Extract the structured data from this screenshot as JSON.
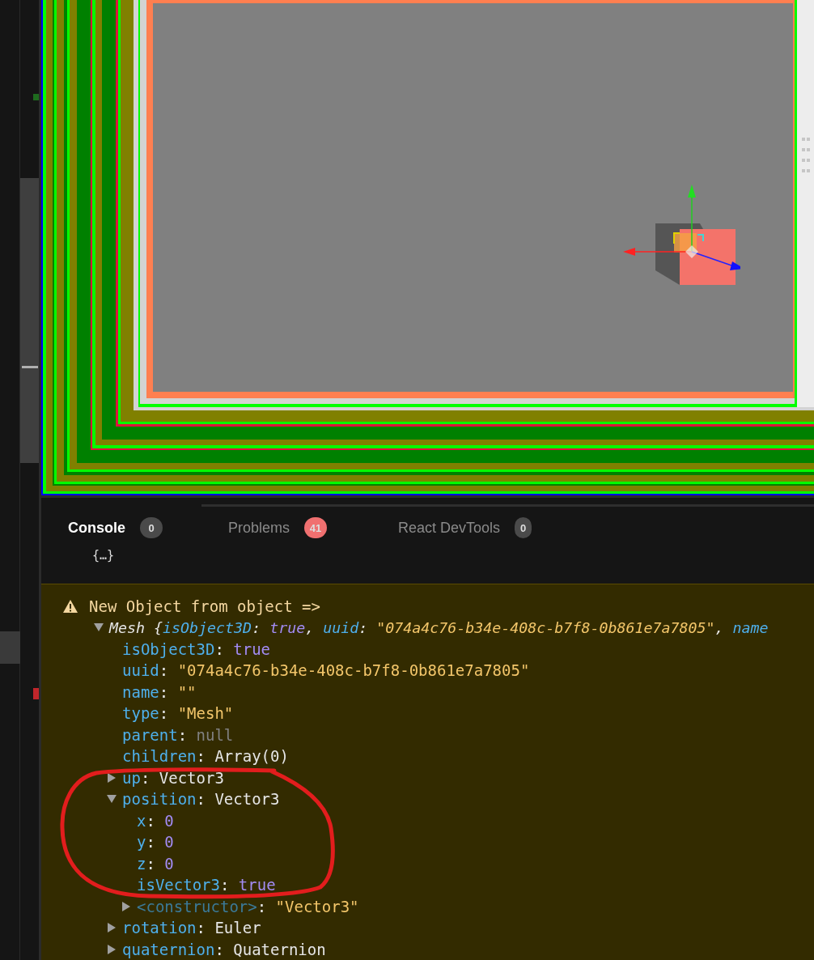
{
  "tabs": [
    {
      "label": "Console",
      "count": "0",
      "selected": true,
      "color": "#4a4a4a"
    },
    {
      "label": "Problems",
      "count": "41",
      "selected": false,
      "color": "#f07070"
    },
    {
      "label": "React DevTools",
      "count": "0",
      "selected": false,
      "color": "#4a4a4a"
    }
  ],
  "syntax": {
    "colon": ": ",
    "comma": ", ",
    "open_brace": "{"
  },
  "console": {
    "fragment": "{…}",
    "warning": {
      "message": "New Object from object =>",
      "object": {
        "type_name": "Mesh",
        "expanded": true,
        "preview": [
          {
            "key": "isObject3D",
            "value": "true",
            "kind": "boolean"
          },
          {
            "key": "uuid",
            "value": "\"074a4c76-b34e-408c-b7f8-0b861e7a7805\"",
            "kind": "string"
          },
          {
            "key": "name"
          }
        ],
        "properties": [
          {
            "key": "isObject3D",
            "value": "true",
            "kind": "boolean"
          },
          {
            "key": "uuid",
            "value": "\"074a4c76-b34e-408c-b7f8-0b861e7a7805\"",
            "kind": "string"
          },
          {
            "key": "name",
            "value": "\"\"",
            "kind": "string"
          },
          {
            "key": "type",
            "value": "\"Mesh\"",
            "kind": "string"
          },
          {
            "key": "parent",
            "value": "null",
            "kind": "null"
          },
          {
            "key": "children",
            "value": "Array(0)",
            "kind": "object"
          },
          {
            "key": "up",
            "value": "Vector3",
            "kind": "object",
            "expanded": false
          },
          {
            "key": "position",
            "value": "Vector3",
            "kind": "object",
            "expanded": true,
            "children": [
              {
                "key": "x",
                "value": "0",
                "kind": "number"
              },
              {
                "key": "y",
                "value": "0",
                "kind": "number"
              },
              {
                "key": "z",
                "value": "0",
                "kind": "number"
              },
              {
                "key": "isVector3",
                "value": "true",
                "kind": "boolean"
              },
              {
                "key": "<constructor>",
                "value": "\"Vector3\"",
                "kind": "string",
                "internal": true,
                "expanded": false
              }
            ]
          },
          {
            "key": "rotation",
            "value": "Euler",
            "kind": "object",
            "expanded": false
          },
          {
            "key": "quaternion",
            "value": "Quaternion",
            "kind": "object",
            "expanded": false
          }
        ]
      }
    }
  }
}
